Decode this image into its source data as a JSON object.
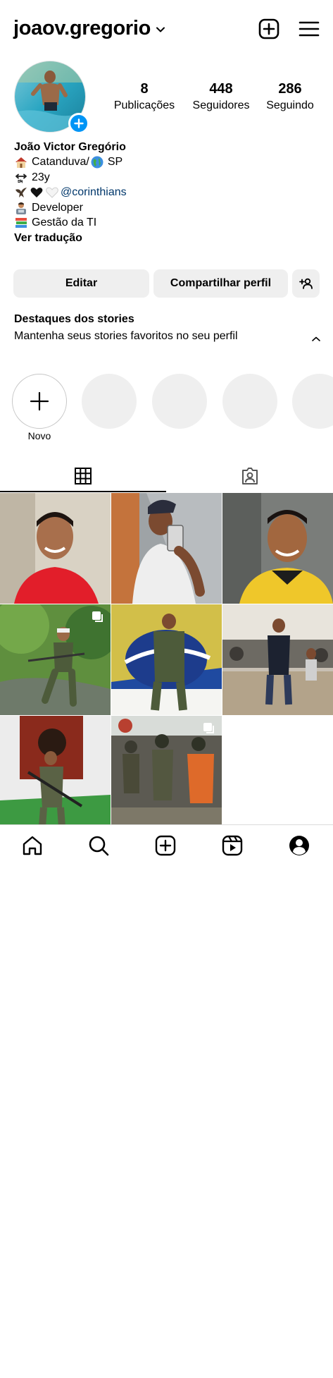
{
  "header": {
    "username": "joaov.gregorio",
    "icons": [
      "chevron-down-icon",
      "new-post-icon",
      "hamburger-menu-icon"
    ]
  },
  "profile": {
    "stats": [
      {
        "value": "8",
        "label": "Publicações"
      },
      {
        "value": "448",
        "label": "Seguidores"
      },
      {
        "value": "286",
        "label": "Seguindo"
      }
    ],
    "bio": {
      "name": "João Victor Gregório",
      "location": "Catanduva/",
      "location_suffix": "SP",
      "age": "23y",
      "mention": "@corinthians",
      "role": "Developer",
      "study": "Gestão da TI",
      "translate": "Ver tradução"
    }
  },
  "actions": {
    "edit": "Editar",
    "share": "Compartilhar perfil"
  },
  "highlights": {
    "title": "Destaques dos stories",
    "subtitle": "Mantenha seus stories favoritos no seu perfil",
    "new_label": "Novo"
  },
  "colors": {
    "accent": "#0095f6",
    "mention": "#00376b",
    "button_bg": "#efefef"
  }
}
